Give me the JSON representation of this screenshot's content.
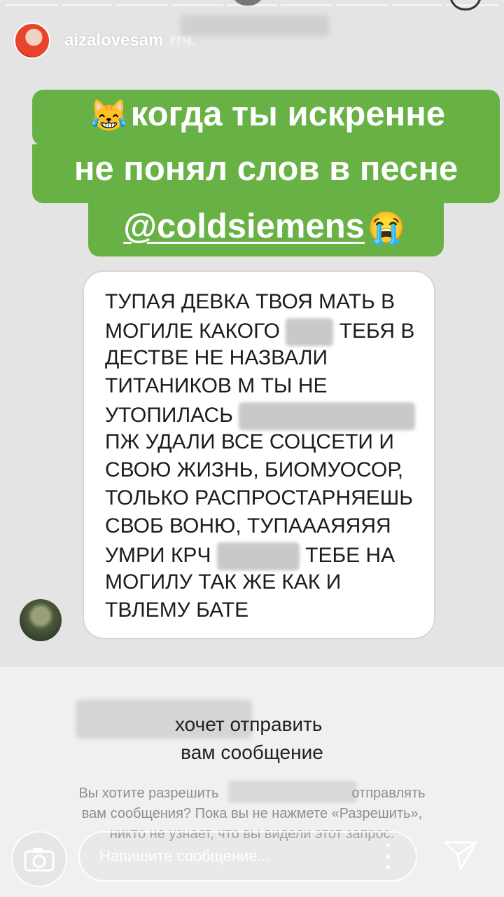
{
  "story": {
    "username": "aizalovesam",
    "time_blurred": "ггч.",
    "caption": {
      "line1": "когда ты искренне",
      "line2": "не понял слов в песне",
      "mention": "@coldsiemens",
      "emoji_start": "😹",
      "emoji_end": "😭",
      "bg_color": "#68b245"
    }
  },
  "message": {
    "line1": "ТУПАЯ ДЕВКА ТВОЯ МАТЬ В",
    "line2a": "МОГИЛЕ КАКОГО",
    "line2b": "ТЕБЯ В",
    "line3": "ДЕСТВЕ НЕ НАЗВАЛИ",
    "line4": "ТИТАНИКОВ М ТЫ НЕ",
    "line5": "УТОПИЛАСЬ",
    "line6": "ПЖ УДАЛИ ВСЕ СОЦСЕТИ И",
    "line7": "СВОЮ ЖИЗНЬ, БИОМУОСОР,",
    "line8": "ТОЛЬКО РАСПРОСТАРНЯЕШЬ",
    "line9": "СВОБ ВОНЮ, ТУПААAЯЯЯЯ",
    "line10a": "УМРИ КРЧ",
    "line10b": "ТЕБЕ НА",
    "line11": "МОГИЛУ ТАК ЖЕ КАК И",
    "line12": "ТВЛЕМУ БАТЕ"
  },
  "request": {
    "title_line1": "хочет отправить",
    "title_line2": "вам сообщение",
    "body_line1_a": "Вы хотите разрешить",
    "body_line1_b": "отправлять",
    "body_line2": "вам сообщения? Пока вы не нажмете «Разрешить»,",
    "body_line3": "никто не узнает, что вы видели этот запрос."
  },
  "reply": {
    "placeholder": "Напишите сообщение..."
  },
  "icons": [
    "camera-icon",
    "more-icon",
    "send-icon"
  ]
}
